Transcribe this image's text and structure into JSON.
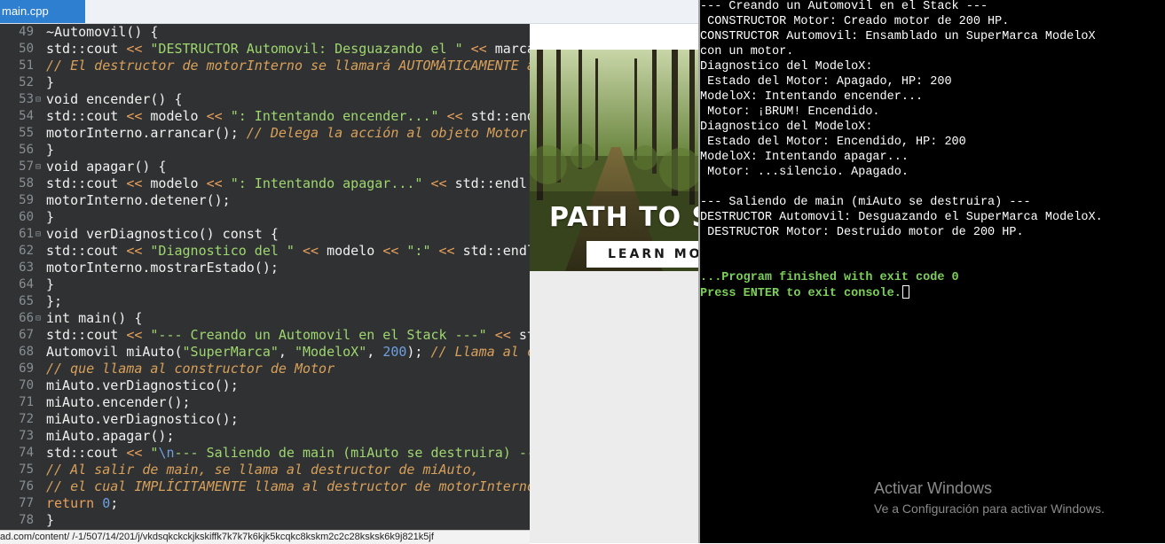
{
  "editor": {
    "tab_label": "main.cpp",
    "lines": [
      {
        "n": "49",
        "fold": "",
        "tokens": [
          [
            "p",
            "~Automovil() {"
          ]
        ]
      },
      {
        "n": "50",
        "fold": "",
        "tokens": [
          [
            "p",
            "std::cout "
          ],
          [
            "o",
            "<<"
          ],
          [
            "p",
            " "
          ],
          [
            "s",
            "\"DESTRUCTOR Automovil: Desguazando el \""
          ],
          [
            "p",
            " "
          ],
          [
            "o",
            "<<"
          ],
          [
            "p",
            " marca"
          ]
        ]
      },
      {
        "n": "51",
        "fold": "",
        "tokens": [
          [
            "c",
            "// El destructor de motorInterno se llamará AUTOMÁTICAMENTE aq"
          ]
        ]
      },
      {
        "n": "52",
        "fold": "",
        "tokens": [
          [
            "p",
            "}"
          ]
        ]
      },
      {
        "n": "53",
        "fold": "⊟",
        "tokens": [
          [
            "p",
            "void encender() {"
          ]
        ]
      },
      {
        "n": "54",
        "fold": "",
        "tokens": [
          [
            "p",
            "std::cout "
          ],
          [
            "o",
            "<<"
          ],
          [
            "p",
            " modelo "
          ],
          [
            "o",
            "<<"
          ],
          [
            "p",
            " "
          ],
          [
            "s",
            "\": Intentando encender...\""
          ],
          [
            "p",
            " "
          ],
          [
            "o",
            "<<"
          ],
          [
            "p",
            " std::endl"
          ]
        ]
      },
      {
        "n": "55",
        "fold": "",
        "tokens": [
          [
            "p",
            "motorInterno.arrancar(); "
          ],
          [
            "c",
            "// Delega la acción al objeto Motor"
          ]
        ]
      },
      {
        "n": "56",
        "fold": "",
        "tokens": [
          [
            "p",
            "}"
          ]
        ]
      },
      {
        "n": "57",
        "fold": "⊟",
        "tokens": [
          [
            "p",
            "void apagar() {"
          ]
        ]
      },
      {
        "n": "58",
        "fold": "",
        "tokens": [
          [
            "p",
            "std::cout "
          ],
          [
            "o",
            "<<"
          ],
          [
            "p",
            " modelo "
          ],
          [
            "o",
            "<<"
          ],
          [
            "p",
            " "
          ],
          [
            "s",
            "\": Intentando apagar...\""
          ],
          [
            "p",
            " "
          ],
          [
            "o",
            "<<"
          ],
          [
            "p",
            " std::endl;"
          ]
        ]
      },
      {
        "n": "59",
        "fold": "",
        "tokens": [
          [
            "p",
            "motorInterno.detener();"
          ]
        ]
      },
      {
        "n": "60",
        "fold": "",
        "tokens": [
          [
            "p",
            "}"
          ]
        ]
      },
      {
        "n": "61",
        "fold": "⊟",
        "tokens": [
          [
            "p",
            "void verDiagnostico() const {"
          ]
        ]
      },
      {
        "n": "62",
        "fold": "",
        "tokens": [
          [
            "p",
            "std::cout "
          ],
          [
            "o",
            "<<"
          ],
          [
            "p",
            " "
          ],
          [
            "s",
            "\"Diagnostico del \""
          ],
          [
            "p",
            " "
          ],
          [
            "o",
            "<<"
          ],
          [
            "p",
            " modelo "
          ],
          [
            "o",
            "<<"
          ],
          [
            "p",
            " "
          ],
          [
            "s",
            "\":\""
          ],
          [
            "p",
            " "
          ],
          [
            "o",
            "<<"
          ],
          [
            "p",
            " std::endl;"
          ]
        ]
      },
      {
        "n": "63",
        "fold": "",
        "tokens": [
          [
            "p",
            "motorInterno.mostrarEstado();"
          ]
        ]
      },
      {
        "n": "64",
        "fold": "",
        "tokens": [
          [
            "p",
            "}"
          ]
        ]
      },
      {
        "n": "65",
        "fold": "",
        "tokens": [
          [
            "p",
            "};"
          ]
        ]
      },
      {
        "n": "66",
        "fold": "⊟",
        "tokens": [
          [
            "p",
            "int main() {"
          ]
        ]
      },
      {
        "n": "67",
        "fold": "",
        "tokens": [
          [
            "p",
            "std::cout "
          ],
          [
            "o",
            "<<"
          ],
          [
            "p",
            " "
          ],
          [
            "s",
            "\"--- Creando un Automovil en el Stack ---\""
          ],
          [
            "p",
            " "
          ],
          [
            "o",
            "<<"
          ],
          [
            "p",
            " std"
          ]
        ]
      },
      {
        "n": "68",
        "fold": "",
        "tokens": [
          [
            "p",
            "Automovil miAuto("
          ],
          [
            "s",
            "\"SuperMarca\""
          ],
          [
            "p",
            ", "
          ],
          [
            "s",
            "\"ModeloX\""
          ],
          [
            "p",
            ", "
          ],
          [
            "n",
            "200"
          ],
          [
            "p",
            "); "
          ],
          [
            "c",
            "// Llama al co"
          ]
        ]
      },
      {
        "n": "69",
        "fold": "",
        "tokens": [
          [
            "c",
            "// que llama al constructor de Motor"
          ]
        ]
      },
      {
        "n": "70",
        "fold": "",
        "tokens": [
          [
            "p",
            "miAuto.verDiagnostico();"
          ]
        ]
      },
      {
        "n": "71",
        "fold": "",
        "tokens": [
          [
            "p",
            "miAuto.encender();"
          ]
        ]
      },
      {
        "n": "72",
        "fold": "",
        "tokens": [
          [
            "p",
            "miAuto.verDiagnostico();"
          ]
        ]
      },
      {
        "n": "73",
        "fold": "",
        "tokens": [
          [
            "p",
            "miAuto.apagar();"
          ]
        ]
      },
      {
        "n": "74",
        "fold": "",
        "tokens": [
          [
            "p",
            "std::cout "
          ],
          [
            "o",
            "<<"
          ],
          [
            "p",
            " "
          ],
          [
            "s",
            "\""
          ],
          [
            "n",
            "\\n"
          ],
          [
            "s",
            "--- Saliendo de main (miAuto se destruira) ---"
          ]
        ]
      },
      {
        "n": "75",
        "fold": "",
        "tokens": [
          [
            "c",
            "// Al salir de main, se llama al destructor de miAuto,"
          ]
        ]
      },
      {
        "n": "76",
        "fold": "",
        "tokens": [
          [
            "c",
            "// el cual IMPLÍCITAMENTE llama al destructor de motorInterno."
          ]
        ]
      },
      {
        "n": "77",
        "fold": "",
        "tokens": [
          [
            "o",
            "return"
          ],
          [
            "p",
            " "
          ],
          [
            "n",
            "0"
          ],
          [
            "p",
            ";"
          ]
        ]
      },
      {
        "n": "78",
        "fold": "",
        "tokens": [
          [
            "p",
            "}"
          ]
        ]
      }
    ]
  },
  "ad": {
    "headline": "PATH TO SU",
    "button_label": "LEARN MO"
  },
  "console": {
    "lines": [
      {
        "text": "--- Creando un Automovil en el Stack ---",
        "style": "normal"
      },
      {
        "text": " CONSTRUCTOR Motor: Creado motor de 200 HP.",
        "style": "normal"
      },
      {
        "text": "CONSTRUCTOR Automovil: Ensamblado un SuperMarca ModeloX",
        "style": "normal"
      },
      {
        "text": "con un motor.",
        "style": "normal"
      },
      {
        "text": "Diagnostico del ModeloX:",
        "style": "normal"
      },
      {
        "text": " Estado del Motor: Apagado, HP: 200",
        "style": "normal"
      },
      {
        "text": "ModeloX: Intentando encender...",
        "style": "normal"
      },
      {
        "text": " Motor: ¡BRUM! Encendido.",
        "style": "normal"
      },
      {
        "text": "Diagnostico del ModeloX:",
        "style": "normal"
      },
      {
        "text": " Estado del Motor: Encendido, HP: 200",
        "style": "normal"
      },
      {
        "text": "ModeloX: Intentando apagar...",
        "style": "normal"
      },
      {
        "text": " Motor: ...silencio. Apagado.",
        "style": "normal"
      },
      {
        "text": "",
        "style": "normal"
      },
      {
        "text": "--- Saliendo de main (miAuto se destruira) ---",
        "style": "normal"
      },
      {
        "text": "DESTRUCTOR Automovil: Desguazando el SuperMarca ModeloX.",
        "style": "normal"
      },
      {
        "text": " DESTRUCTOR Motor: Destruido motor de 200 HP.",
        "style": "normal"
      },
      {
        "text": "",
        "style": "normal"
      },
      {
        "text": "",
        "style": "normal"
      },
      {
        "text": "...Program finished with exit code 0",
        "style": "green"
      },
      {
        "text": "Press ENTER to exit console.",
        "style": "green",
        "cursor": true
      }
    ]
  },
  "watermark": {
    "title": "Activar Windows",
    "subtitle": "Ve a Configuración para activar Windows."
  },
  "status_url": "ad.com/content/ /-1/507/14/201/j/vkdsqkckckjkskiffk7k7k7k6kjk5kcqkc8kskm2c2c28ksksk6k9j821k5jf",
  "colors": {
    "editor_bg": "#2f3133",
    "keyword_operator": "#e8a05a",
    "string": "#9fd66f",
    "comment": "#d9a15a",
    "number": "#6ea0e0",
    "console_bg": "#000000",
    "console_green": "#7cd05a",
    "tab_active": "#2f7fd0"
  }
}
